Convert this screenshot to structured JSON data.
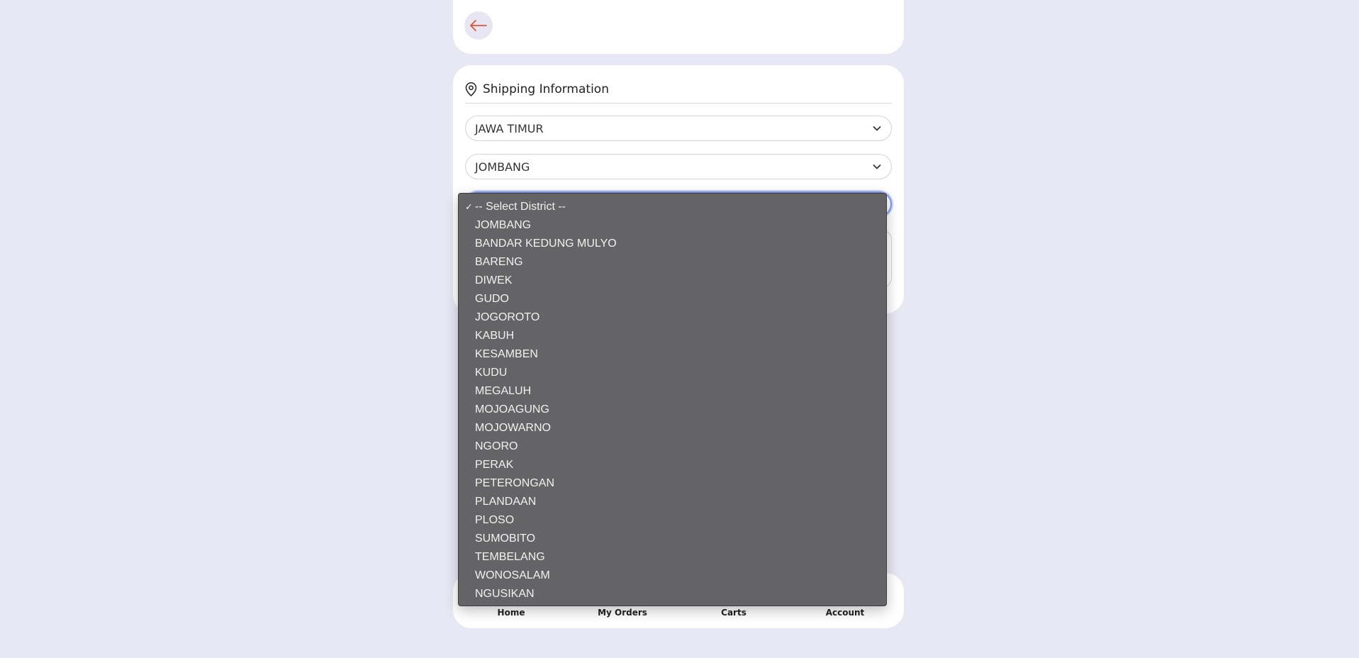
{
  "header": {
    "back_icon": "arrow-left-icon"
  },
  "shipping": {
    "title": "Shipping Information",
    "title_icon": "map-pin-icon",
    "province_value": "JAWA TIMUR",
    "city_value": "JOMBANG",
    "district_value": "-- Select District --",
    "address_value": ""
  },
  "district_dropdown": {
    "selected_index": 0,
    "options": [
      "-- Select District --",
      "JOMBANG",
      "BANDAR KEDUNG MULYO",
      "BARENG",
      "DIWEK",
      "GUDO",
      "JOGOROTO",
      "KABUH",
      "KESAMBEN",
      "KUDU",
      "MEGALUH",
      "MOJOAGUNG",
      "MOJOWARNO",
      "NGORO",
      "PERAK",
      "PETERONGAN",
      "PLANDAAN",
      "PLOSO",
      "SUMOBITO",
      "TEMBELANG",
      "WONOSALAM",
      "NGUSIKAN"
    ]
  },
  "bottom_nav": {
    "items": [
      {
        "label": "Home"
      },
      {
        "label": "My Orders"
      },
      {
        "label": "Carts"
      },
      {
        "label": "Account"
      }
    ]
  },
  "colors": {
    "background": "#e8e8f4",
    "card": "#ffffff",
    "back_arrow": "#e0553a",
    "dropdown_bg": "#646466",
    "focus_ring": "#7f9be8"
  }
}
